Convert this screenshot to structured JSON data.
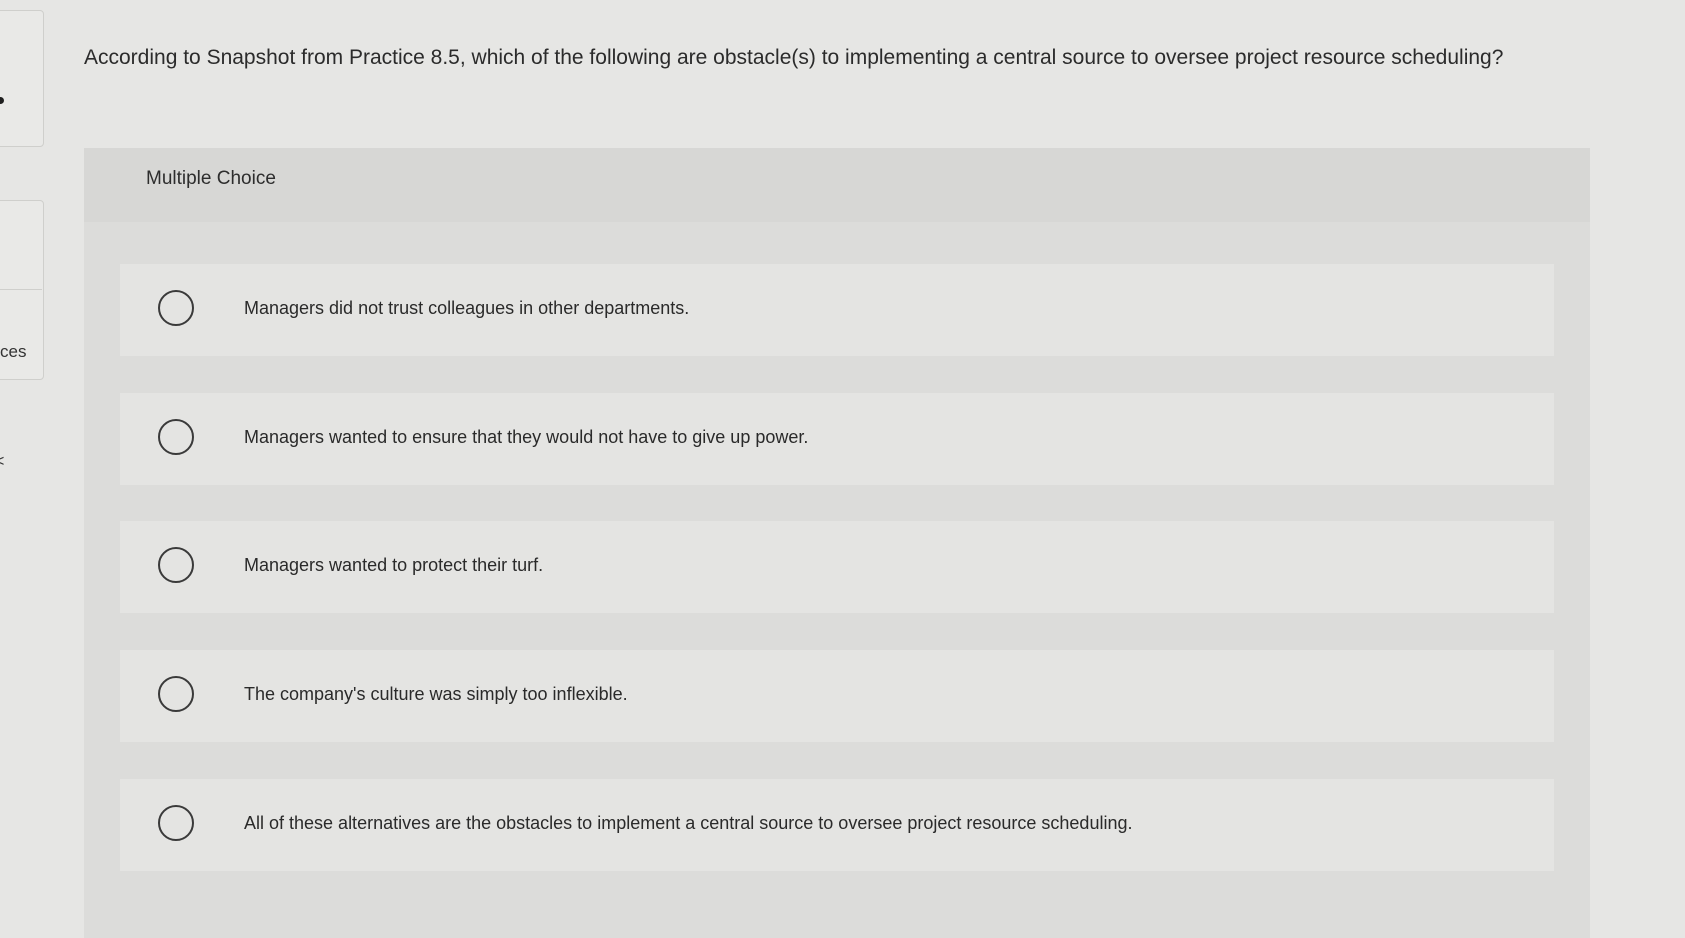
{
  "sidebar": {
    "caret": "<",
    "label": "ces"
  },
  "question": {
    "text": "According to Snapshot from Practice 8.5, which of the following are obstacle(s) to implementing a central source to oversee project resource scheduling?"
  },
  "multiple_choice": {
    "title": "Multiple Choice",
    "options": [
      {
        "label": "Managers did not trust colleagues in other departments.",
        "selected": false
      },
      {
        "label": "Managers wanted to ensure that they would not have to give up power.",
        "selected": false
      },
      {
        "label": "Managers wanted to protect their turf.",
        "selected": false
      },
      {
        "label": "The company's culture was simply too inflexible.",
        "selected": false
      },
      {
        "label": "All of these alternatives are the obstacles to implement a central source to oversee project resource scheduling.",
        "selected": false
      }
    ]
  }
}
